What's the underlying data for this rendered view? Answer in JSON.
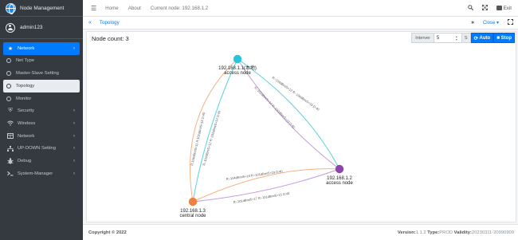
{
  "sidebar": {
    "brand": "Node Management",
    "user": "admin123",
    "items": [
      {
        "label": "Network",
        "icon": "star-icon",
        "chevron": "‹"
      },
      {
        "label": "Net Type",
        "icon": "circle-icon"
      },
      {
        "label": "Master-Slave Setting",
        "icon": "circle-icon"
      },
      {
        "label": "Topology",
        "icon": "circle-icon"
      },
      {
        "label": "Monitor",
        "icon": "circle-icon"
      },
      {
        "label": "Security",
        "icon": "shield-icon",
        "chevron": "‹"
      },
      {
        "label": "Wireless",
        "icon": "wifi-icon",
        "chevron": "‹"
      },
      {
        "label": "Network",
        "icon": "table-icon",
        "chevron": "‹"
      },
      {
        "label": "UP-DOWN Setting",
        "icon": "sitemap-icon",
        "chevron": "‹"
      },
      {
        "label": "Debug",
        "icon": "bug-icon",
        "chevron": "‹"
      },
      {
        "label": "System-Manager",
        "icon": "terminal-icon",
        "chevron": "‹"
      }
    ]
  },
  "header": {
    "home": "Home",
    "about": "About",
    "current_node": "Current node: 192.168.1.2",
    "exit": "Exit"
  },
  "tabs": {
    "active": "Topology",
    "close": "Close ▾"
  },
  "content": {
    "node_count_label": "Node count:",
    "node_count": "3",
    "interval_label": "Interver",
    "interval_value": "5",
    "interval_unit": "S",
    "auto_label": "Auto",
    "stop_label": "Stop"
  },
  "topology": {
    "nodes": [
      {
        "ip": "192.168.1.1(本地)",
        "role": "access node",
        "color": "#26c6da"
      },
      {
        "ip": "192.168.1.2",
        "role": "access node",
        "color": "#8e44ad"
      },
      {
        "ip": "192.168.1.3",
        "role": "central node",
        "color": "#f0803c"
      }
    ],
    "links": [
      "R:104dBm/5+11 R:102dBm/5+18 D:40",
      "R:-104dBm/5+12 R:-102dBm/5+14 D:40",
      "R:-102dBm/5+14 R:-100dBm/5+13 D:40",
      "R:-104dBm/5+12 R:-106dBm/5+16 D:40",
      "R:-104dBm/5+16 R:-101dBm/5+19 D:40",
      "R:-101dBm/5+17 R:-101dBm/5+15 D:40"
    ]
  },
  "footer": {
    "copyright": "Copyright © 2022",
    "version_label": "Version:",
    "version": "1.1.2",
    "type_label": "Type:",
    "type": "PROD",
    "validity_label": "Validity:",
    "validity": "20230311-20990909"
  }
}
